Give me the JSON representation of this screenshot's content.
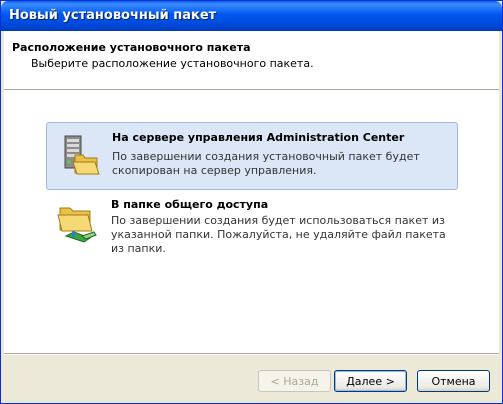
{
  "window": {
    "title": "Новый установочный пакет"
  },
  "header": {
    "title": "Расположение установочного пакета",
    "subtitle": "Выберите расположение установочного пакета."
  },
  "options": [
    {
      "title": "На сервере управления Administration Center",
      "description": "По завершении создания установочный пакет будет скопирован на сервер управления.",
      "icon": "server-folder-icon",
      "selected": true
    },
    {
      "title": "В папке общего доступа",
      "description": "По завершении создания будет использоваться пакет из указанной папки. Пожалуйста, не удаляйте файл пакета из папки.",
      "icon": "shared-folder-icon",
      "selected": false
    }
  ],
  "buttons": {
    "back": "< Назад",
    "next": "Далее >",
    "cancel": "Отмена"
  }
}
